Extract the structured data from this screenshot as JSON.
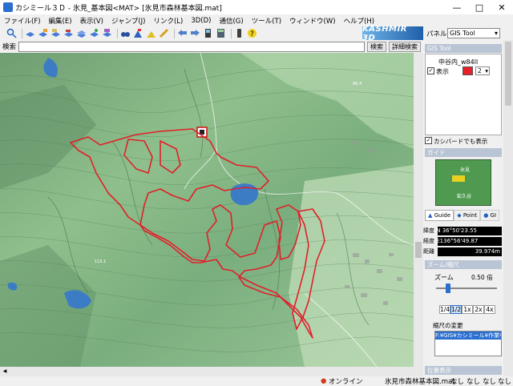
{
  "window": {
    "title": "カシミール３Ｄ - 氷見_基本図<MAT> [氷見市森林基本図.mat]",
    "min_icon": "minimize-icon",
    "max_icon": "maximize-icon",
    "close_icon": "close-icon"
  },
  "menu": [
    "ファイル(F)",
    "編集(E)",
    "表示(V)",
    "ジャンプ(J)",
    "リンク(L)",
    "3D(D)",
    "通信(G)",
    "ツール(T)",
    "ウィンドウ(W)",
    "ヘルプ(H)"
  ],
  "toolbar": {
    "brand": "KASHMIR 3D",
    "icons": [
      "zoom-search-icon",
      "layer-icon",
      "layer-add-icon",
      "layer-edit-icon",
      "layer-remove-icon",
      "layer-stack-icon",
      "layer-save-icon",
      "layer-export-icon",
      "binoculars-icon",
      "peak-flag-icon",
      "hill-icon",
      "pencil-icon",
      "arrow-left-icon",
      "arrow-right-icon",
      "gps-icon",
      "calculator-icon",
      "phone-icon",
      "help-icon"
    ]
  },
  "search": {
    "label": "検索",
    "value": "",
    "search_button": "検索",
    "detail_button": "詳細検索"
  },
  "map": {
    "labels": [
      "氷見",
      "鉱久谷"
    ]
  },
  "panel": {
    "label": "パネル",
    "select_value": "GIS Tool",
    "gis_header": "GIS Tool",
    "layer_name": "中谷内_w84ll",
    "show_label": "表示",
    "color_number": "2",
    "kashbird_label": "カシバードでも表示",
    "guide_header": "ガイド",
    "guide_labels": [
      "氷見",
      "鉱久谷"
    ],
    "tabs": [
      "Guide",
      "Point",
      "GI"
    ],
    "coords": [
      {
        "label": "緯度",
        "value": "N 36°50'23.55"
      },
      {
        "label": "経度",
        "value": "E136°56'49.87"
      },
      {
        "label": "距離",
        "value": "39.974m"
      }
    ],
    "zoom_header": "ズーム/縮尺",
    "zoom_label": "ズーム",
    "zoom_value": "0.50 倍",
    "zoom_level": 0.2,
    "zoom_buttons": [
      "1/4",
      "1/2",
      "1x",
      "2x",
      "4x"
    ],
    "scale_header": "縮尺の変更",
    "scale_value": "F:¥GIS¥カシミール¥作業¥",
    "bottom_header": "位置表示"
  },
  "status": {
    "online": "オンライン",
    "file": "氷見市森林基本図.mat",
    "cells": [
      "なし",
      "なし",
      "なし",
      "なし"
    ]
  },
  "colors": {
    "accent": "#1f5fa8",
    "route": "#e0202a",
    "map_green": "#7fae84",
    "water": "#4a88c8"
  }
}
